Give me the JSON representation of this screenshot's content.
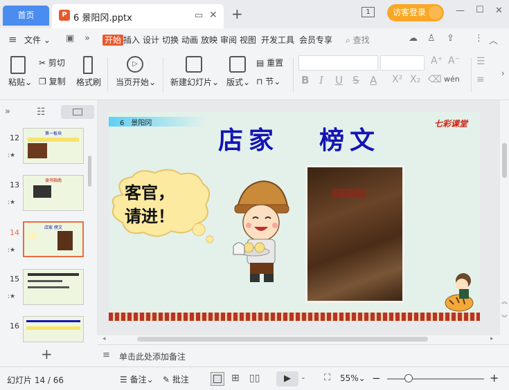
{
  "tabs": {
    "home": "首页",
    "doc_title": "6 景阳冈.pptx",
    "doc_icon": "P",
    "new_tab": "+"
  },
  "window": {
    "visitor_login": "访客登录",
    "badge": "1",
    "minimize": "—",
    "maximize": "☐",
    "close": "✕"
  },
  "menu": {
    "file": "文件",
    "items": [
      "开始",
      "插入",
      "设计",
      "切换",
      "动画",
      "放映",
      "审阅",
      "视图",
      "开发工具",
      "会员专享"
    ],
    "search": "查找"
  },
  "toolbar": {
    "paste": "粘贴",
    "cut": "剪切",
    "copy": "复制",
    "format_painter": "格式刷",
    "play_from_current": "当页开始",
    "new_slide": "新建幻灯片",
    "layout": "版式",
    "reset": "重置",
    "section": "节",
    "pinyin": "wén"
  },
  "thumbnails": [
    {
      "num": "12",
      "selected": false,
      "title": "第一板块"
    },
    {
      "num": "13",
      "selected": false,
      "title": "读书指南"
    },
    {
      "num": "14",
      "selected": true,
      "title": "店家 榜文"
    },
    {
      "num": "15",
      "selected": false,
      "title": ""
    },
    {
      "num": "16",
      "selected": false,
      "title": ""
    }
  ],
  "slide": {
    "header": "6　景阳冈",
    "title_left": "店家",
    "title_right": "榜文",
    "logo": "七彩课堂",
    "bubble_line1": "客官，",
    "bubble_line2": "请进！"
  },
  "notes": {
    "placeholder": "单击此处添加备注"
  },
  "status": {
    "slide_counter": "幻灯片 14 / 66",
    "notes": "备注",
    "comments": "批注",
    "zoom": "55%",
    "zoom_level": 0.55
  },
  "colors": {
    "accent": "#4a8cf0",
    "brand": "#e9592e",
    "visitor": "#f9a825",
    "title": "#1414b4"
  }
}
